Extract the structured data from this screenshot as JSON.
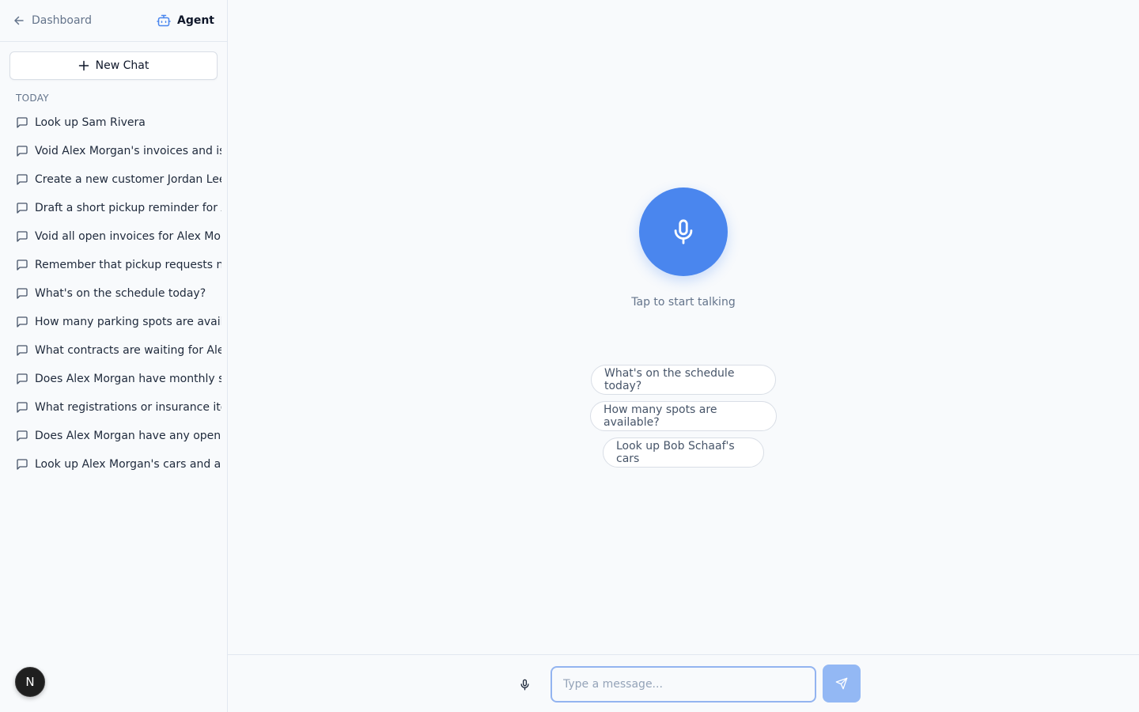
{
  "sidebar": {
    "back_label": "Dashboard",
    "title": "Agent",
    "new_chat_label": "New Chat",
    "section_label": "TODAY",
    "chats": [
      "Look up Sam Rivera",
      "Void Alex Morgan's invoices and issue",
      "Create a new customer Jordan Lee, with",
      "Draft a short pickup reminder for Alex",
      "Void all open invoices for Alex Morgan",
      "Remember that pickup requests need",
      "What's on the schedule today?",
      "How many parking spots are available",
      "What contracts are waiting for Alex Morgan",
      "Does Alex Morgan have monthly storage",
      "What registrations or insurance items",
      "Does Alex Morgan have any open invoices",
      "Look up Alex Morgan's cars and any"
    ],
    "avatar_initial": "N"
  },
  "main": {
    "tap_label": "Tap to start talking",
    "suggestions": [
      "What's on the schedule today?",
      "How many spots are available?",
      "Look up Bob Schaaf's cars"
    ]
  },
  "composer": {
    "placeholder": "Type a message...",
    "value": ""
  },
  "colors": {
    "accent": "#4a86ee",
    "send_disabled": "#93b8f4",
    "input_focus": "#93b4f0"
  }
}
